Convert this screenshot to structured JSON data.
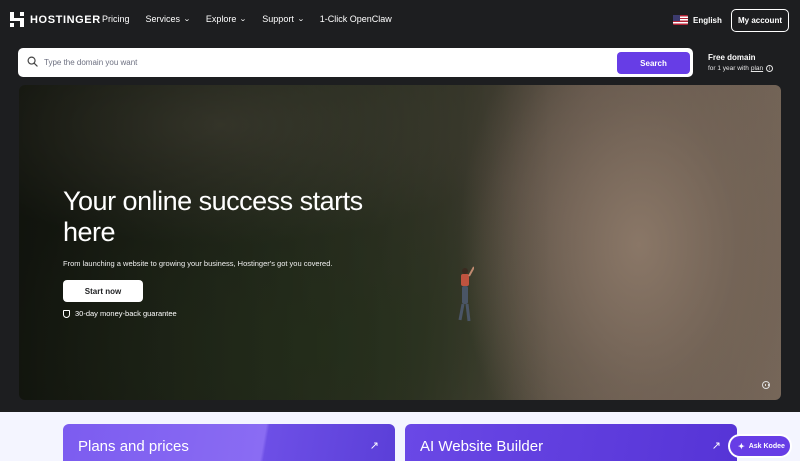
{
  "brand": {
    "name": "HOSTINGER"
  },
  "nav": {
    "links": [
      {
        "label": "Pricing",
        "dropdown": false
      },
      {
        "label": "Services",
        "dropdown": true
      },
      {
        "label": "Explore",
        "dropdown": true
      },
      {
        "label": "Support",
        "dropdown": true
      },
      {
        "label": "1-Click OpenClaw",
        "dropdown": false
      }
    ],
    "language": "English",
    "account_button": "My account"
  },
  "search": {
    "placeholder": "Type the domain you want",
    "button": "Search"
  },
  "free_domain": {
    "title": "Free domain",
    "subtitle": "for 1 year with",
    "link": "plan"
  },
  "hero": {
    "title": "Your online success starts here",
    "subtitle": "From launching a website to growing your business, Hostinger's got you covered.",
    "cta": "Start now",
    "guarantee": "30-day money-back guarantee"
  },
  "cards": [
    {
      "title": "Plans and prices",
      "arrow": "↗"
    },
    {
      "title": "AI Website Builder",
      "arrow": "↗"
    }
  ],
  "assistant": {
    "label": "Ask Kodee"
  },
  "colors": {
    "accent": "#673de6",
    "background": "#1d1e20"
  }
}
